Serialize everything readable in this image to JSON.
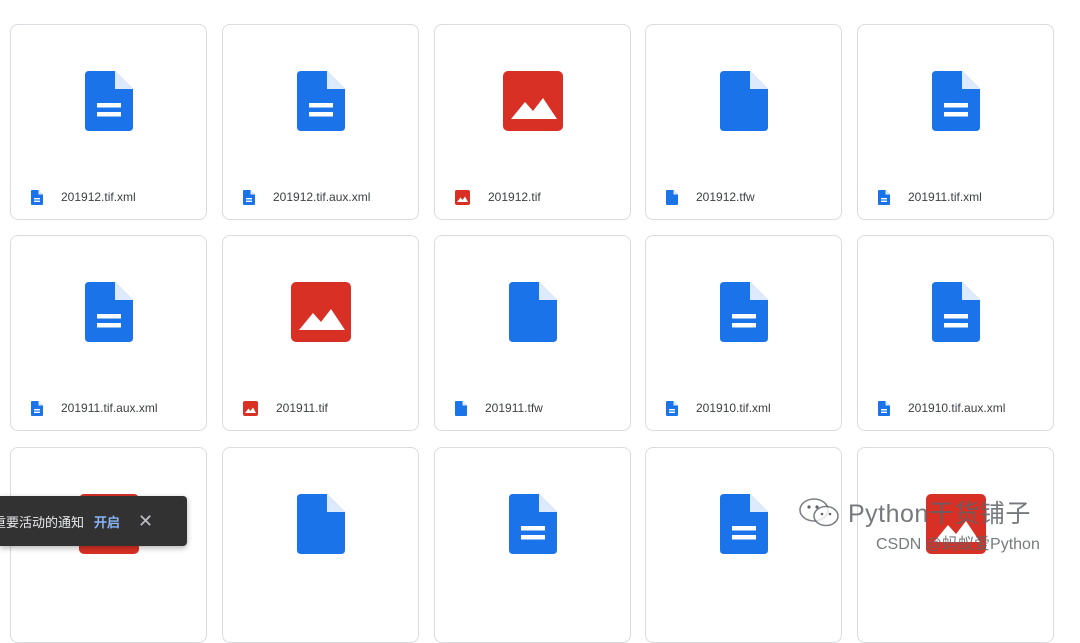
{
  "files": [
    {
      "name": "201912.tif.xml",
      "type": "doc"
    },
    {
      "name": "201912.tif.aux.xml",
      "type": "doc"
    },
    {
      "name": "201912.tif",
      "type": "image"
    },
    {
      "name": "201912.tfw",
      "type": "blank"
    },
    {
      "name": "201911.tif.xml",
      "type": "doc"
    },
    {
      "name": "201911.tif.aux.xml",
      "type": "doc"
    },
    {
      "name": "201911.tif",
      "type": "image"
    },
    {
      "name": "201911.tfw",
      "type": "blank"
    },
    {
      "name": "201910.tif.xml",
      "type": "doc"
    },
    {
      "name": "201910.tif.aux.xml",
      "type": "doc"
    },
    {
      "name": "",
      "type": "image"
    },
    {
      "name": "",
      "type": "blank"
    },
    {
      "name": "",
      "type": "doc"
    },
    {
      "name": "",
      "type": "doc"
    },
    {
      "name": "",
      "type": "image"
    }
  ],
  "toast": {
    "message": "获取重要活动的通知",
    "action": "开启",
    "close_icon": "close-icon"
  },
  "watermark": {
    "title": "Python干货铺子",
    "credit": "CSDN @蚂蚁爱Python"
  },
  "colors": {
    "doc_blue": "#1a73e8",
    "image_red": "#d93025",
    "border": "#dadce0",
    "toast_bg": "#323232",
    "toast_action": "#8ab4f8"
  }
}
